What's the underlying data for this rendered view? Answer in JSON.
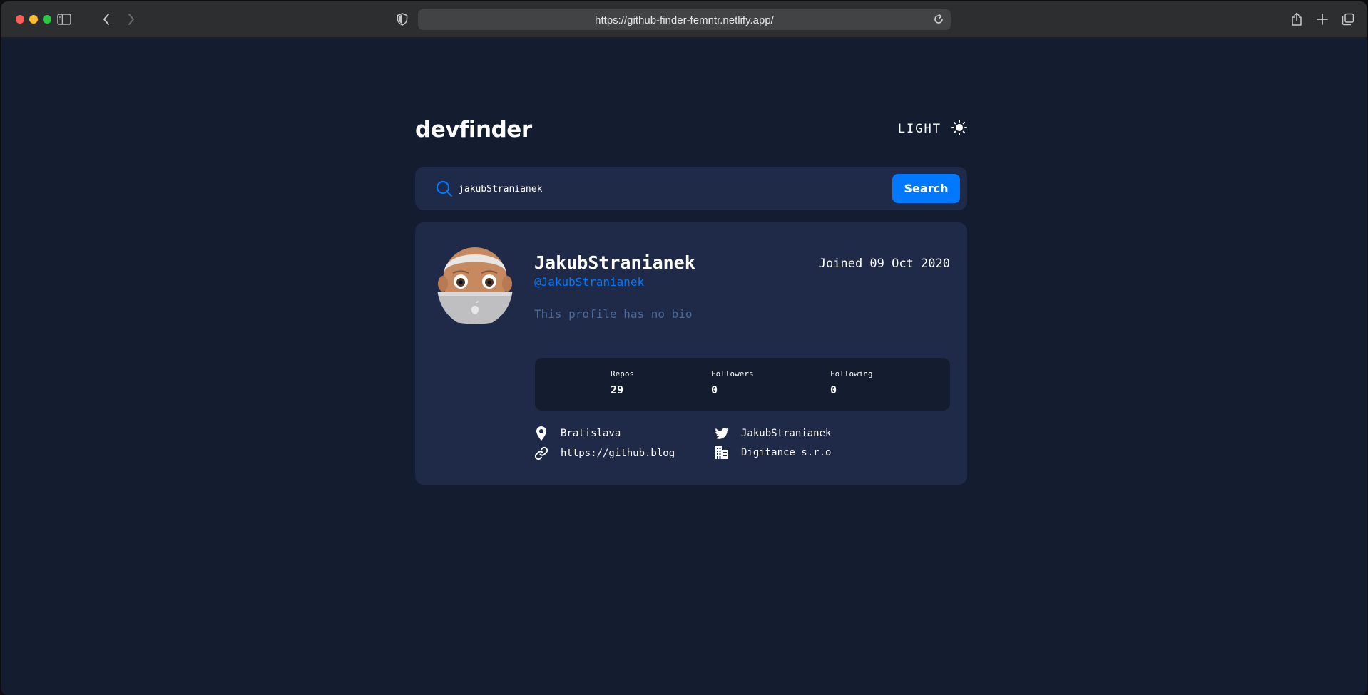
{
  "browser": {
    "url": "https://github-finder-femntr.netlify.app/"
  },
  "header": {
    "logo": "devfinder",
    "theme_label": "LIGHT"
  },
  "search": {
    "value": "jakubStranianek",
    "button_label": "Search"
  },
  "profile": {
    "name": "JakubStranianek",
    "handle": "@JakubStranianek",
    "joined": "Joined 09 Oct 2020",
    "bio": "This profile has no bio"
  },
  "stats": [
    {
      "label": "Repos",
      "value": "29"
    },
    {
      "label": "Followers",
      "value": "0"
    },
    {
      "label": "Following",
      "value": "0"
    }
  ],
  "links": {
    "location": "Bratislava",
    "website": "https://github.blog",
    "twitter": "JakubStranianek",
    "company": "Digitance s.r.o"
  },
  "colors": {
    "background": "#141d2f",
    "card": "#1e2a47",
    "accent": "#0079ff",
    "muted": "#4b6a9b"
  }
}
